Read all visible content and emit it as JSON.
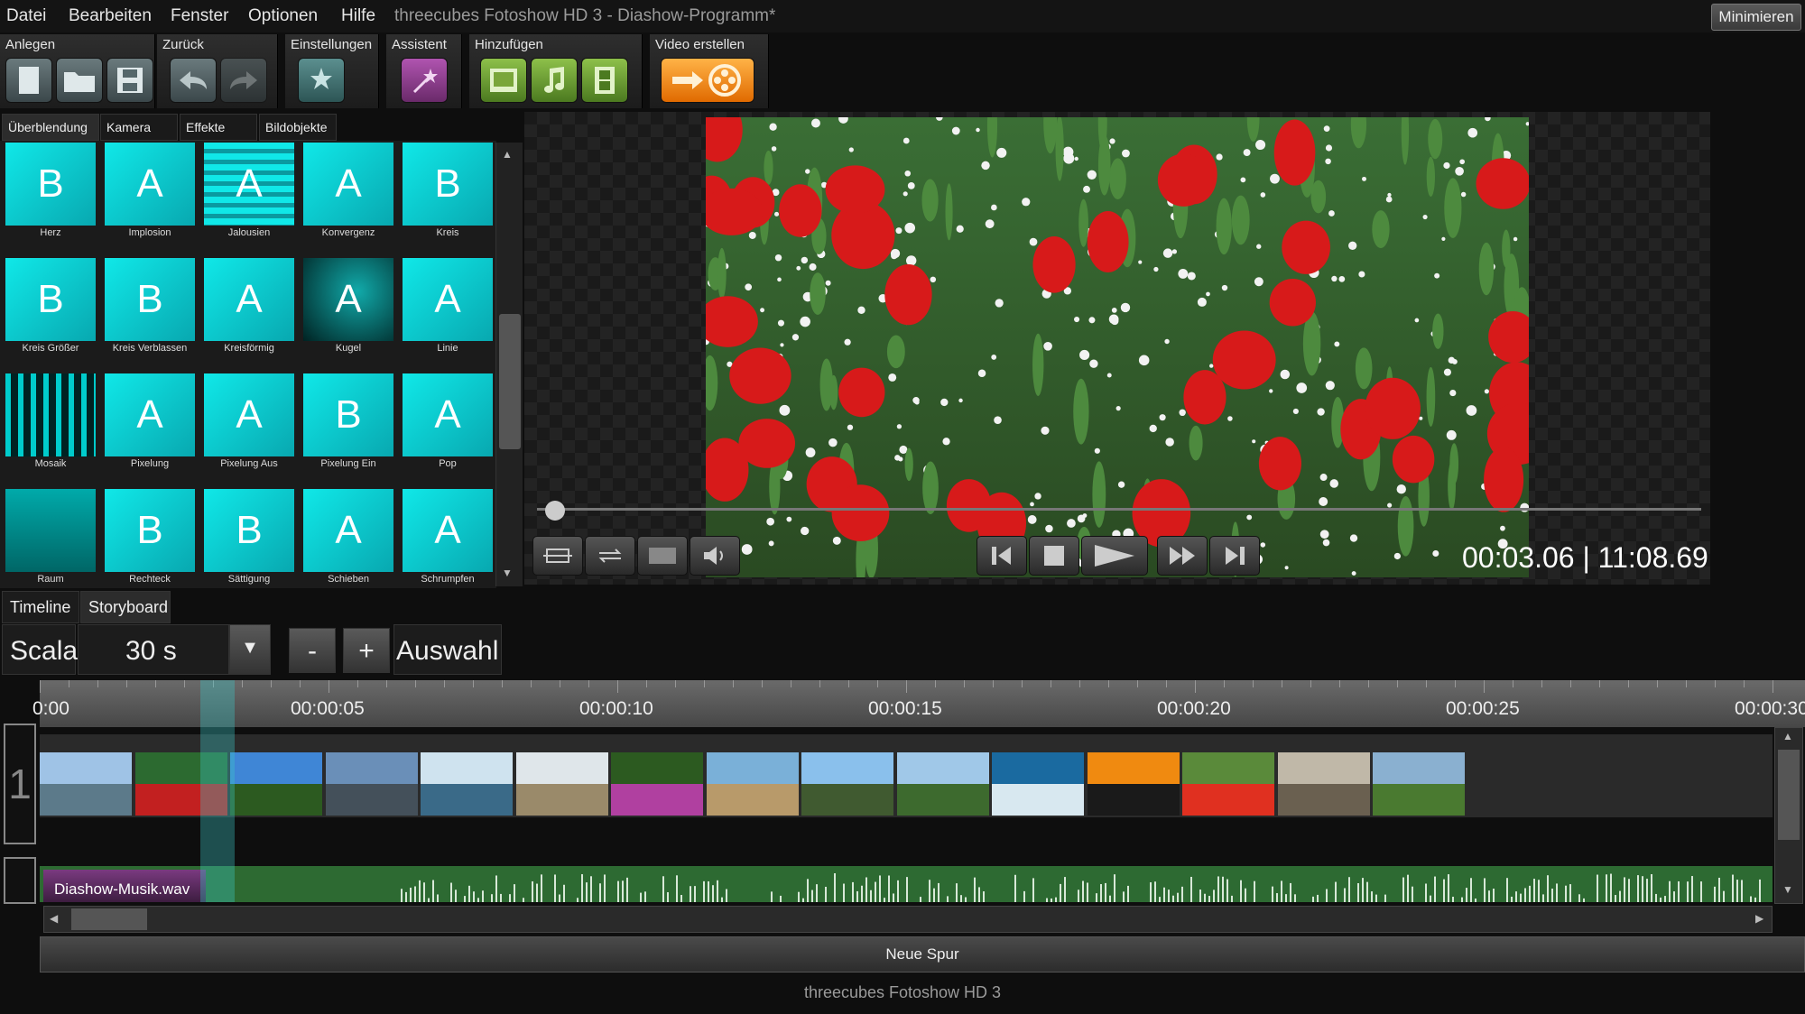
{
  "menu": {
    "items": [
      "Datei",
      "Bearbeiten",
      "Fenster",
      "Optionen",
      "Hilfe"
    ],
    "title": "threecubes Fotoshow HD 3 - Diashow-Programm*",
    "minimize": "Minimieren"
  },
  "ribbon": {
    "groups": [
      {
        "label": "Anlegen"
      },
      {
        "label": "Zurück"
      },
      {
        "label": "Einstellungen"
      },
      {
        "label": "Assistent"
      },
      {
        "label": "Hinzufügen"
      },
      {
        "label": "Video erstellen"
      }
    ]
  },
  "tabs": [
    "Überblendung",
    "Kamera",
    "Effekte",
    "Bildobjekte"
  ],
  "transitions": [
    {
      "glyph": "B",
      "label": "Herz"
    },
    {
      "glyph": "A",
      "label": "Implosion"
    },
    {
      "glyph": "A",
      "label": "Jalousien"
    },
    {
      "glyph": "A",
      "label": "Konvergenz"
    },
    {
      "glyph": "B",
      "label": "Kreis"
    },
    {
      "glyph": "B",
      "label": "Kreis Größer"
    },
    {
      "glyph": "B",
      "label": "Kreis Verblassen"
    },
    {
      "glyph": "A",
      "label": "Kreisförmig"
    },
    {
      "glyph": "A",
      "label": "Kugel"
    },
    {
      "glyph": "A",
      "label": "Linie"
    },
    {
      "glyph": "",
      "label": "Mosaik"
    },
    {
      "glyph": "A",
      "label": "Pixelung"
    },
    {
      "glyph": "A",
      "label": "Pixelung Aus"
    },
    {
      "glyph": "B",
      "label": "Pixelung Ein"
    },
    {
      "glyph": "A",
      "label": "Pop"
    },
    {
      "glyph": "",
      "label": "Raum"
    },
    {
      "glyph": "B",
      "label": "Rechteck"
    },
    {
      "glyph": "B",
      "label": "Sättigung"
    },
    {
      "glyph": "A",
      "label": "Schieben"
    },
    {
      "glyph": "A",
      "label": "Schrumpfen"
    }
  ],
  "player": {
    "timecode": "00:03.06 | 11:08.69",
    "progress": 0.005
  },
  "bottom_tabs": [
    "Timeline",
    "Storyboard"
  ],
  "scale": {
    "label": "Scala",
    "value": "30 s",
    "minus": "-",
    "plus": "+",
    "selection": "Auswahl"
  },
  "timeline": {
    "ruler": [
      "0:00",
      "00:00:05",
      "00:00:10",
      "00:00:15",
      "00:00:20",
      "00:00:25",
      "00:00:30"
    ],
    "track_number": "1",
    "audio_clip": "Diashow-Musik.wav",
    "new_track": "Neue Spur"
  },
  "footer": "threecubes Fotoshow HD 3",
  "colors": {
    "accent_cyan": "#10e8e8",
    "audio_green": "#2d6a32",
    "video_orange": "#ff9a1a"
  }
}
